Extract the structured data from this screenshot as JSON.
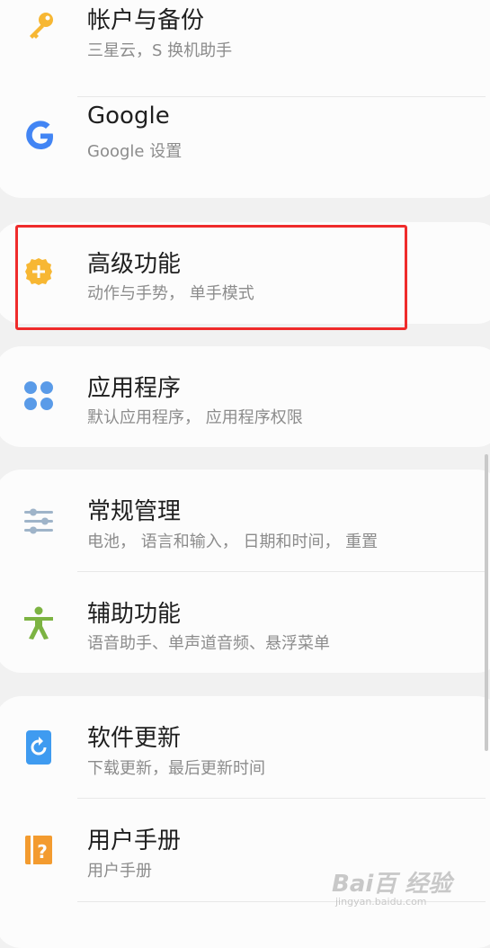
{
  "groups": [
    {
      "items": [
        {
          "title": "帐户与备份",
          "subtitle": "三星云，S 换机助手",
          "icon": "key-icon",
          "color": "#f7b733"
        },
        {
          "title": "Google",
          "subtitle": "Google 设置",
          "icon": "google-icon",
          "color": "#4285f4"
        }
      ]
    },
    {
      "items": [
        {
          "title": "高级功能",
          "subtitle": "动作与手势， 单手模式",
          "icon": "advanced-features-gear-icon",
          "color": "#f7b733"
        }
      ]
    },
    {
      "items": [
        {
          "title": "应用程序",
          "subtitle": "默认应用程序， 应用程序权限",
          "icon": "apps-grid-icon",
          "color": "#5a9be8"
        }
      ]
    },
    {
      "items": [
        {
          "title": "常规管理",
          "subtitle": "电池， 语言和输入， 日期和时间， 重置",
          "icon": "sliders-icon",
          "color": "#9fb4c9"
        },
        {
          "title": "辅助功能",
          "subtitle": "语音助手、单声道音频、悬浮菜单",
          "icon": "accessibility-person-icon",
          "color": "#7cb342"
        }
      ]
    },
    {
      "items": [
        {
          "title": "软件更新",
          "subtitle": "下载更新，最后更新时间",
          "icon": "software-update-icon",
          "color": "#3f9bf0"
        },
        {
          "title": "用户手册",
          "subtitle": "用户手册",
          "icon": "user-manual-icon",
          "color": "#f39b2f"
        }
      ]
    }
  ],
  "highlight_color": "#ef2b2b",
  "watermark": {
    "main": "Bai百 经验",
    "sub": "jingyan.baidu.com"
  }
}
